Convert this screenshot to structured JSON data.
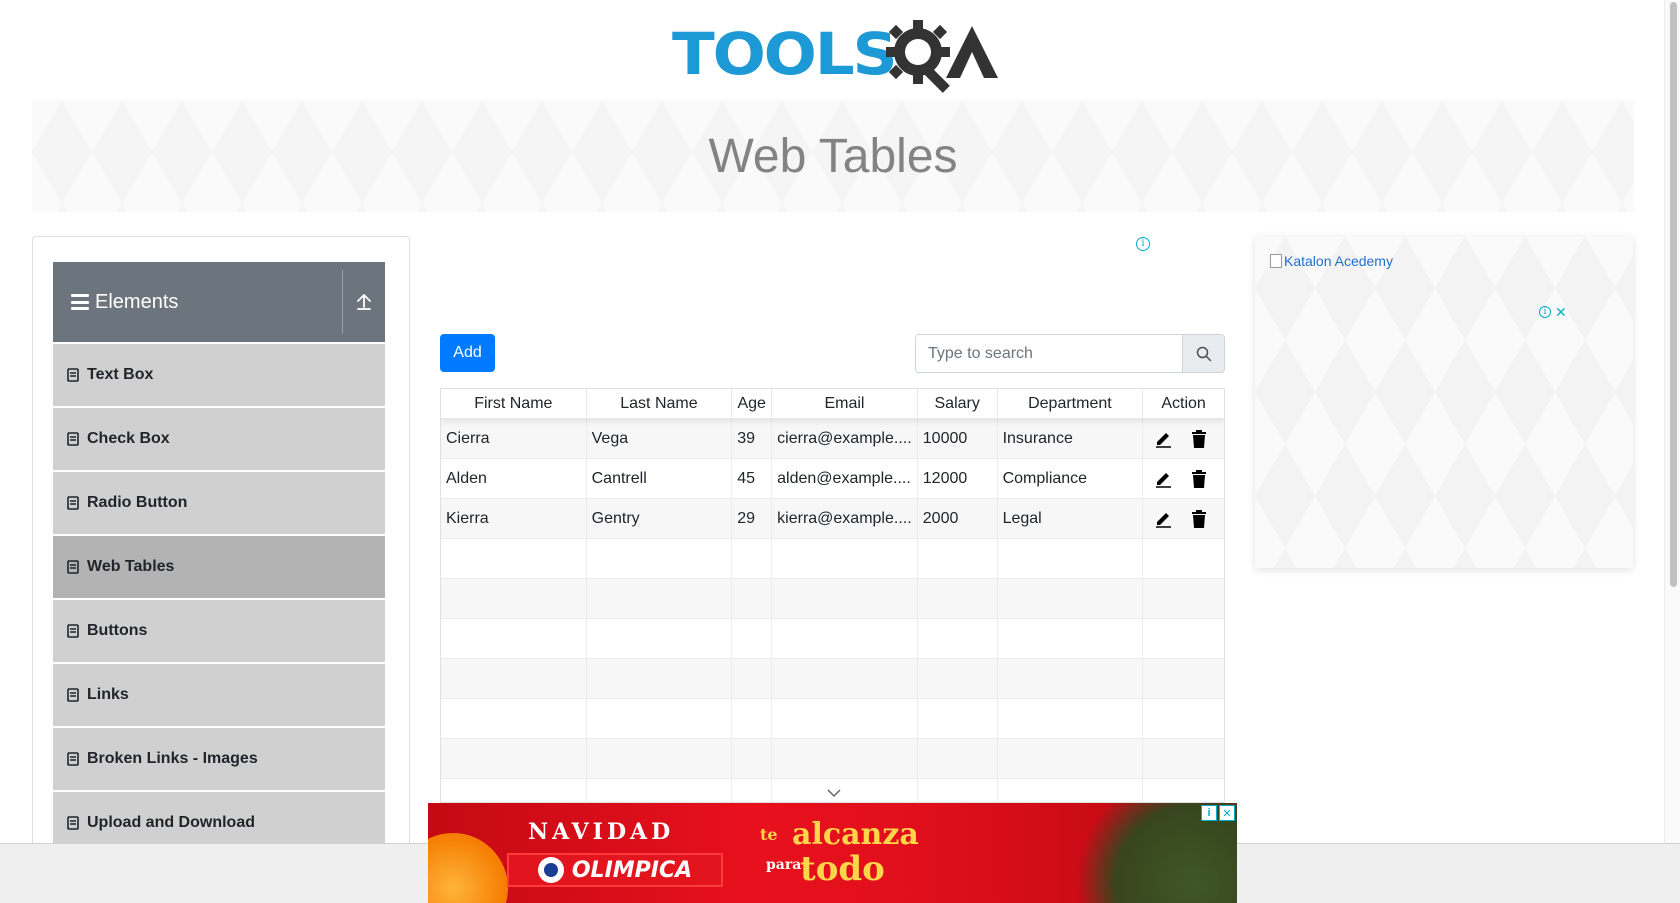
{
  "logo": {
    "text_tools": "TOOLS",
    "text_a": "A"
  },
  "page": {
    "title": "Web Tables"
  },
  "sidebar": {
    "group_title": "Elements",
    "items": [
      {
        "label": "Text Box",
        "active": false
      },
      {
        "label": "Check Box",
        "active": false
      },
      {
        "label": "Radio Button",
        "active": false
      },
      {
        "label": "Web Tables",
        "active": true
      },
      {
        "label": "Buttons",
        "active": false
      },
      {
        "label": "Links",
        "active": false
      },
      {
        "label": "Broken Links - Images",
        "active": false
      },
      {
        "label": "Upload and Download",
        "active": false
      }
    ]
  },
  "toolbar": {
    "add_label": "Add",
    "search_placeholder": "Type to search"
  },
  "table": {
    "headers": [
      "First Name",
      "Last Name",
      "Age",
      "Email",
      "Salary",
      "Department",
      "Action"
    ],
    "rows": [
      [
        "Cierra",
        "Vega",
        "39",
        "cierra@example....",
        "10000",
        "Insurance"
      ],
      [
        "Alden",
        "Cantrell",
        "45",
        "alden@example....",
        "12000",
        "Compliance"
      ],
      [
        "Kierra",
        "Gentry",
        "29",
        "kierra@example....",
        "2000",
        "Legal"
      ]
    ],
    "empty_rows": 7
  },
  "right_ad": {
    "alt_text": "Katalon Acedemy"
  },
  "bottom_ad": {
    "headline": "NAVIDAD",
    "brand": "OLIMPICA",
    "slogan_1": "te",
    "slogan_2": "alcanza",
    "slogan_3": "para",
    "slogan_4": "todo"
  },
  "colors": {
    "primary": "#007bff",
    "sidebar_header": "#6c757d",
    "sidebar_item": "#d0d0d0",
    "sidebar_item_active": "#b3b3b3",
    "logo_blue": "#1d9ad6",
    "logo_dark": "#333333"
  }
}
